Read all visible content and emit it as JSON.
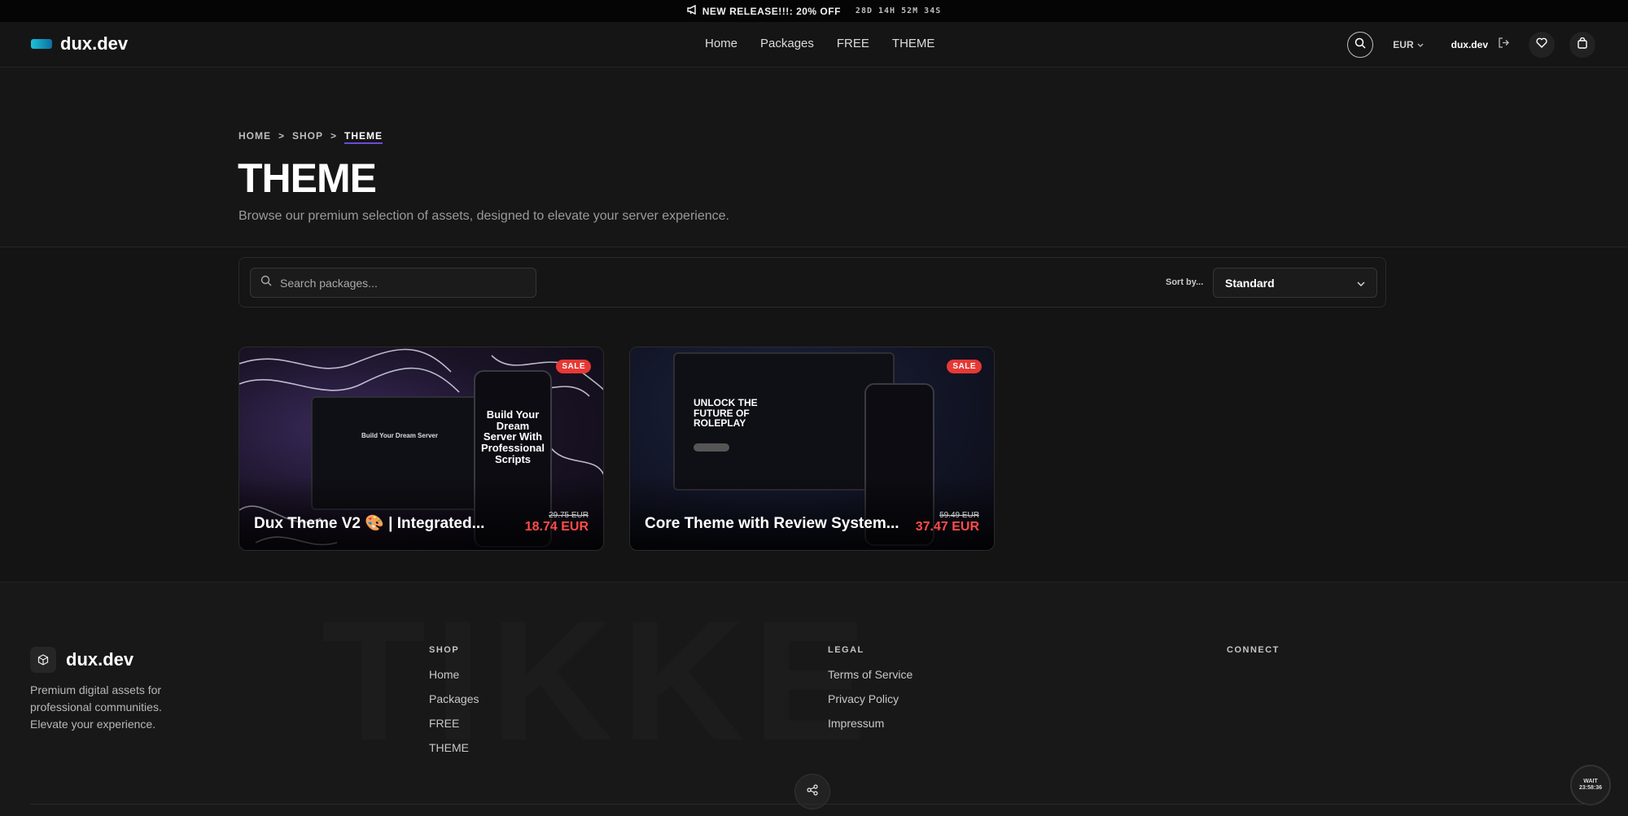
{
  "announcement": {
    "message": "NEW RELEASE!!!: 20% OFF",
    "countdown": "28D 14H 52M 34S"
  },
  "navbar": {
    "brand_name": "dux.dev",
    "links": [
      "Home",
      "Packages",
      "FREE",
      "THEME"
    ],
    "currency": "EUR",
    "user_name": "dux.dev"
  },
  "breadcrumb": {
    "home": "HOME",
    "shop": "SHOP",
    "current": "THEME",
    "separator": ">"
  },
  "hero": {
    "title": "THEME",
    "subtitle": "Browse our premium selection of assets, designed to elevate your server experience."
  },
  "filters": {
    "search_placeholder": "Search packages...",
    "sort_label": "Sort by...",
    "sort_value": "Standard"
  },
  "products": [
    {
      "title": "Dux Theme V2 🎨 | Integrated...",
      "badge": "SALE",
      "old_price": "29.75 EUR",
      "new_price": "18.74 EUR",
      "image_text": "Build Your Dream Server With Professional Scripts"
    },
    {
      "title": "Core Theme with Review System...",
      "badge": "SALE",
      "old_price": "59.49 EUR",
      "new_price": "37.47 EUR",
      "image_text": "UNLOCK THE FUTURE OF ROLEPLAY"
    }
  ],
  "footer": {
    "brand_name": "dux.dev",
    "tagline": "Premium digital assets for professional communities. Elevate your experience.",
    "shop": {
      "heading": "SHOP",
      "links": [
        "Home",
        "Packages",
        "FREE",
        "THEME"
      ]
    },
    "legal": {
      "heading": "LEGAL",
      "links": [
        "Terms of Service",
        "Privacy Policy",
        "Impressum"
      ]
    },
    "connect": {
      "heading": "CONNECT"
    },
    "watermark": "TIKKE",
    "clock": {
      "label": "WAIT",
      "time": "23:58:36"
    }
  },
  "colors": {
    "background": "#141414",
    "accent": "#6c4bd8",
    "sale_red": "#e53935",
    "price_red": "#ff4b4b",
    "brand_cyan": "#1bc3d8"
  },
  "icons": [
    "megaphone-icon",
    "search-icon",
    "chevron-down-icon",
    "logout-icon",
    "heart-icon",
    "cart-icon",
    "cube-icon",
    "share-icon"
  ]
}
